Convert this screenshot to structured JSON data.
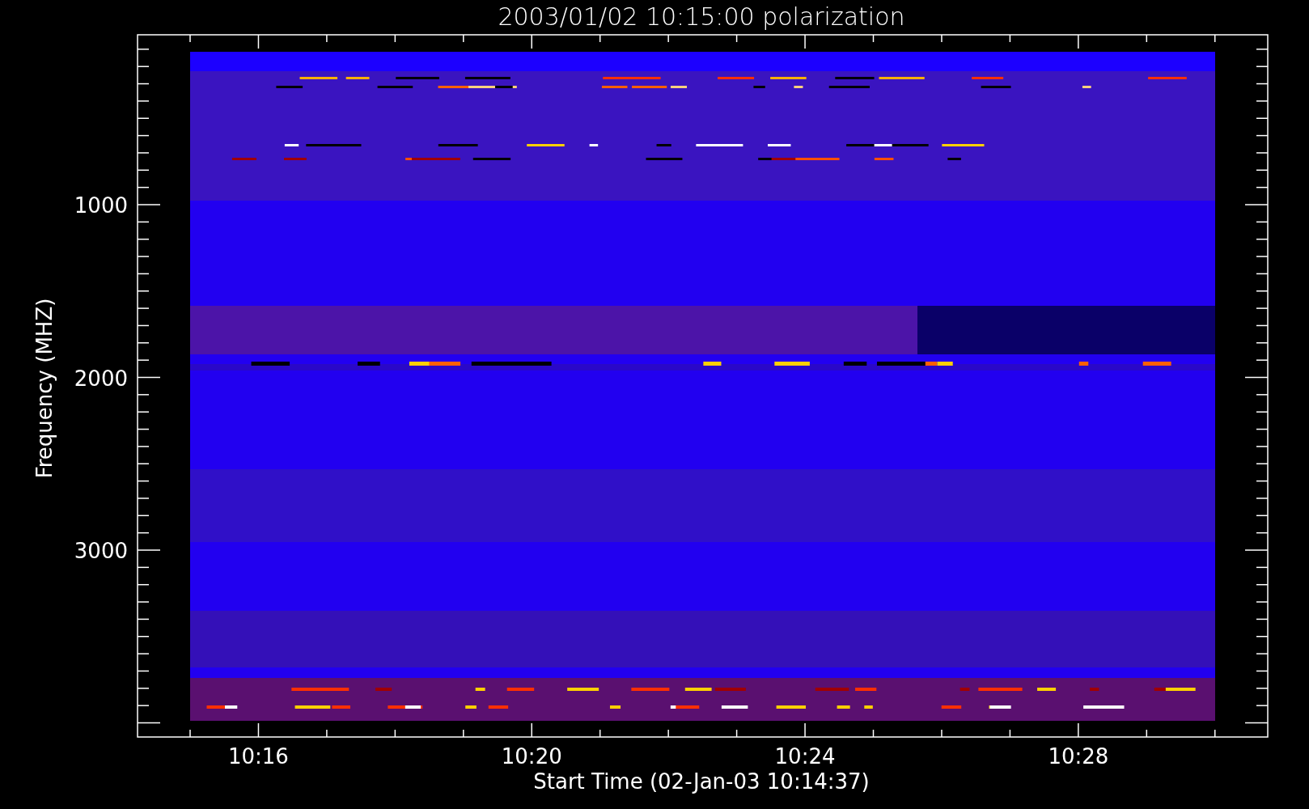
{
  "title": "2003/01/02 10:15:00 polarization",
  "y_axis": {
    "label": "Frequency (MHZ)",
    "ticks": [
      "1000",
      "2000",
      "3000"
    ]
  },
  "x_axis": {
    "label": "Start Time (02-Jan-03 10:14:37)",
    "ticks": [
      "10:16",
      "10:20",
      "10:24",
      "10:28"
    ]
  }
}
